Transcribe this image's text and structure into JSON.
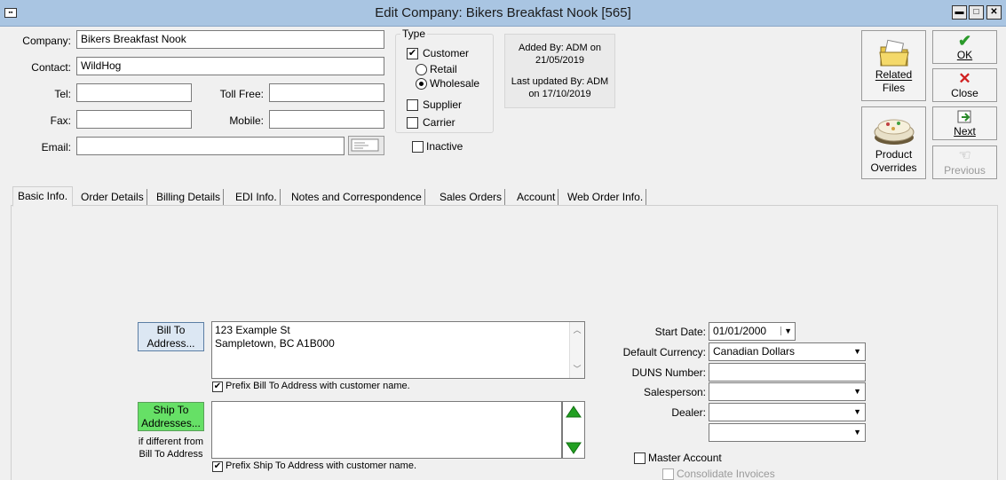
{
  "window": {
    "title": "Edit Company: Bikers Breakfast Nook [565]"
  },
  "company": {
    "company_label": "Company:",
    "company_value": "Bikers Breakfast Nook",
    "contact_label": "Contact:",
    "contact_value": "WildHog",
    "tel_label": "Tel:",
    "tel_value": "",
    "tollfree_label": "Toll Free:",
    "tollfree_value": "",
    "fax_label": "Fax:",
    "fax_value": "",
    "mobile_label": "Mobile:",
    "mobile_value": "",
    "email_label": "Email:",
    "email_value": ""
  },
  "type": {
    "legend": "Type",
    "customer": "Customer",
    "customer_checked": true,
    "retail": "Retail",
    "wholesale": "Wholesale",
    "selected_price": "Wholesale",
    "supplier": "Supplier",
    "carrier": "Carrier",
    "inactive": "Inactive"
  },
  "audit": {
    "added_line1": "Added By: ADM on",
    "added_line2": "21/05/2019",
    "updated_line1": "Last updated By: ADM",
    "updated_line2": "on 17/10/2019"
  },
  "actions": {
    "related_files_line1": "Related",
    "related_files_line2": "Files",
    "product_overrides_line1": "Product",
    "product_overrides_line2": "Overrides",
    "ok": "OK",
    "close": "Close",
    "next": "Next",
    "previous": "Previous"
  },
  "tabs": [
    "Basic Info.",
    "Order Details",
    "Billing Details",
    "EDI Info.",
    "Notes and Correspondence",
    "Sales Orders",
    "Account",
    "Web Order Info."
  ],
  "basic": {
    "bill_to_btn_line1": "Bill To",
    "bill_to_btn_line2": "Address...",
    "bill_address_line1": "123 Example St",
    "bill_address_line2": "Sampletown, BC  A1B000",
    "prefix_bill": "Prefix Bill To Address with customer name.",
    "ship_to_btn_line1": "Ship To",
    "ship_to_btn_line2": "Addresses...",
    "ship_note_line1": "if different from",
    "ship_note_line2": "Bill To Address",
    "prefix_ship": "Prefix Ship To Address with customer name.",
    "start_date_label": "Start Date:",
    "start_date_value": "01/01/2000",
    "currency_label": "Default Currency:",
    "currency_value": "Canadian Dollars",
    "duns_label": "DUNS Number:",
    "duns_value": "",
    "salesperson_label": "Salesperson:",
    "salesperson_value": "",
    "dealer_label": "Dealer:",
    "dealer_value": "",
    "extra_value": "",
    "master_account": "Master Account",
    "consolidate_invoices": "Consolidate Invoices"
  },
  "colors": {
    "titlebar": "#a9c5e2",
    "ship_button": "#66e066",
    "bill_button": "#dce7f3"
  }
}
